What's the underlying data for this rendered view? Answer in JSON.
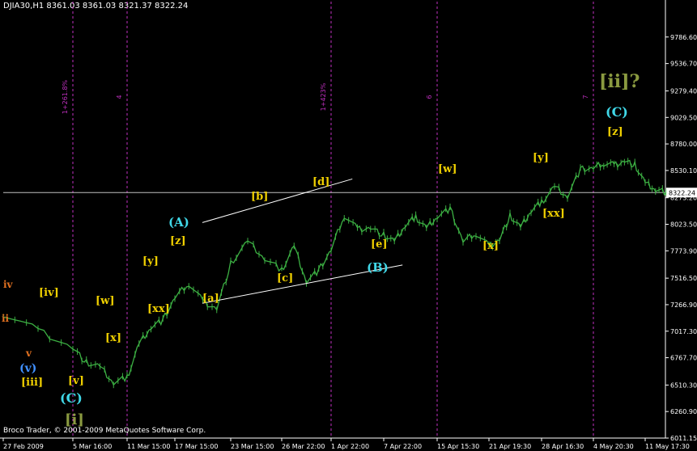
{
  "header": {
    "symbol_line": "DJIA30,H1  8361.03 8361.03 8321.37 8322.24"
  },
  "footer": {
    "copyright": "Broco Trader, © 2001-2009 MetaQuotes Software Corp."
  },
  "colors": {
    "background": "#000000",
    "price": "#3cb043",
    "axis": "#ffffff",
    "period_line": "#c030c0",
    "bid_line": "#c0c0c0",
    "channel": "#ffffff",
    "label_yellow": "#f0d000",
    "label_cyan": "#40d8e8",
    "label_orange": "#e07020",
    "label_blue": "#4090ff",
    "label_olive": "#8a9a40"
  },
  "chart_data": {
    "type": "line",
    "title": "DJIA30,H1",
    "ylim": [
      6011.15,
      10043.6
    ],
    "ytick_labels": [
      "9786.60",
      "9536.70",
      "9279.40",
      "9029.50",
      "8780.00",
      "8530.10",
      "8273.20",
      "8023.50",
      "7773.90",
      "7516.50",
      "7266.90",
      "7017.30",
      "6767.70",
      "6510.30",
      "6260.90",
      "6011.15"
    ],
    "bid_label": "8322.24",
    "xtick_labels": [
      "27 Feb 2009",
      "5 Mar 16:00",
      "11 Mar 15:00",
      "17 Mar 15:00",
      "23 Mar 15:00",
      "26 Mar 22:00",
      "1 Apr 22:00",
      "7 Apr 22:00",
      "15 Apr 15:30",
      "21 Apr 19:30",
      "28 Apr 16:30",
      "4 May 20:30",
      "11 May 17:30"
    ],
    "x": [
      "27 Feb 2009",
      "3 Mar",
      "5 Mar 16:00",
      "6 Mar",
      "9 Mar",
      "10 Mar",
      "11 Mar 15:00",
      "12 Mar",
      "13 Mar",
      "16 Mar",
      "17 Mar 15:00",
      "18 Mar",
      "19 Mar",
      "20 Mar",
      "23 Mar 15:00",
      "24 Mar",
      "25 Mar",
      "26 Mar 22:00",
      "27 Mar",
      "30 Mar",
      "31 Mar",
      "1 Apr 22:00",
      "2 Apr",
      "3 Apr",
      "6 Apr",
      "7 Apr 22:00",
      "8 Apr",
      "9 Apr",
      "13 Apr",
      "14 Apr",
      "15 Apr 15:30",
      "16 Apr",
      "17 Apr",
      "20 Apr",
      "21 Apr 19:30",
      "22 Apr",
      "23 Apr",
      "24 Apr",
      "27 Apr",
      "28 Apr 16:30",
      "29 Apr",
      "30 Apr",
      "1 May",
      "4 May 20:30",
      "5 May",
      "6 May",
      "7 May",
      "8 May",
      "11 May 17:30",
      "12 May",
      "13 May"
    ],
    "values": [
      7180,
      7030,
      6860,
      6720,
      6680,
      6530,
      6580,
      6900,
      7060,
      7120,
      7330,
      7470,
      7300,
      7230,
      7650,
      7860,
      7700,
      7590,
      7820,
      7490,
      7590,
      7780,
      8110,
      7980,
      7990,
      7920,
      7860,
      8010,
      8090,
      7990,
      8100,
      8170,
      7860,
      7940,
      7820,
      7880,
      8100,
      7990,
      8150,
      8230,
      8380,
      8290,
      8540,
      8550,
      8600,
      8580,
      8620,
      8580,
      8410,
      8350,
      8322
    ],
    "series": [
      {
        "name": "DJIA30,H1"
      }
    ],
    "period_separators": [
      "5 Mar 16:00",
      "11 Mar 15:00",
      "1 Apr 22:00",
      "15 Apr 15:30",
      "4 May 20:30"
    ],
    "separator_labels": [
      "1+261.8%",
      "4",
      "1+423%",
      "6",
      "7"
    ],
    "wave_labels": [
      "iv",
      "ii",
      "v",
      "(v)",
      "[iv]",
      "[iii]",
      "[v]",
      "(C)",
      "[i]",
      "[w]",
      "[x]",
      "[xx]",
      "[y]",
      "[z]",
      "(A)",
      "[a]",
      "[b]",
      "[c]",
      "[d]",
      "[e]",
      "(B)",
      "[w]",
      "[x]",
      "[y]",
      "[xx]",
      "[z]",
      "(C)",
      "[ii]?"
    ],
    "channel_lines": [
      {
        "from": [
          "23 Mar 15:00",
          8040
        ],
        "to": [
          "2 Apr",
          8450
        ]
      },
      {
        "from": [
          "23 Mar 15:00",
          7280
        ],
        "to": [
          "8 Apr",
          7640
        ]
      }
    ],
    "grid": false
  }
}
